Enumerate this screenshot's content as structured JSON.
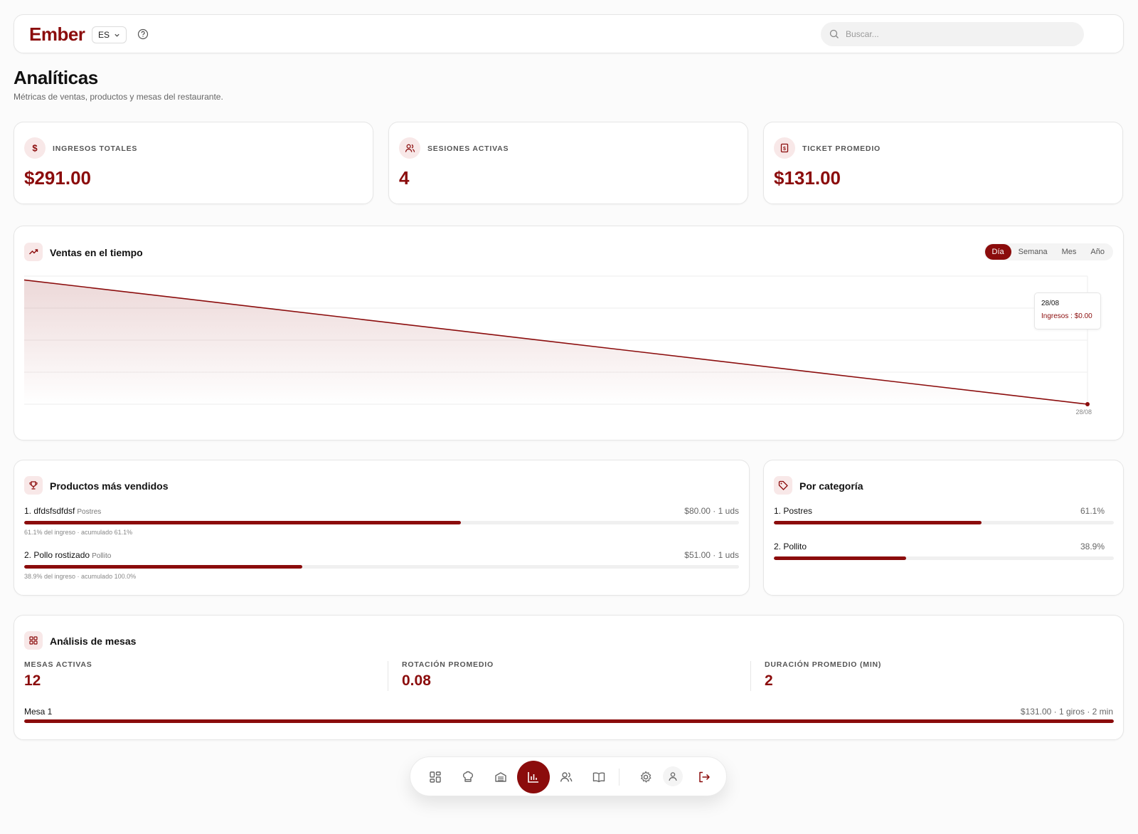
{
  "header": {
    "logo": "Ember",
    "language": "ES",
    "search_placeholder": "Buscar..."
  },
  "page": {
    "title": "Analíticas",
    "subtitle": "Métricas de ventas, productos y mesas del restaurante."
  },
  "kpis": [
    {
      "label": "INGRESOS TOTALES",
      "value": "$291.00",
      "icon": "dollar-icon"
    },
    {
      "label": "SESIONES ACTIVAS",
      "value": "4",
      "icon": "users-icon"
    },
    {
      "label": "TICKET PROMEDIO",
      "value": "$131.00",
      "icon": "receipt-icon"
    }
  ],
  "sales_chart": {
    "title": "Ventas en el tiempo",
    "ranges": [
      "Día",
      "Semana",
      "Mes",
      "Año"
    ],
    "active_range": "Día",
    "tooltip": {
      "date": "28/08",
      "label": "Ingresos : $0.00"
    },
    "x_tick": "28/08"
  },
  "chart_data": {
    "type": "area",
    "title": "Ventas en el tiempo",
    "x": [
      "",
      "28/08"
    ],
    "series": [
      {
        "name": "Ingresos",
        "values": [
          291,
          0
        ]
      }
    ],
    "ylim": [
      0,
      300
    ],
    "grid": true,
    "color": "#8b0c0c"
  },
  "top_products": {
    "title": "Productos más vendidos",
    "items": [
      {
        "rank_name": "1. dfdsfsdfdsf",
        "category": "Postres",
        "right": "$80.00 · 1 uds",
        "share": 0.611,
        "note": "61.1% del ingreso · acumulado 61.1%"
      },
      {
        "rank_name": "2. Pollo rostizado",
        "category": "Pollito",
        "right": "$51.00 · 1 uds",
        "share": 0.389,
        "note": "38.9% del ingreso · acumulado 100.0%"
      }
    ]
  },
  "by_category": {
    "title": "Por categoría",
    "items": [
      {
        "name": "1. Postres",
        "pct": "61.1%",
        "share": 0.611
      },
      {
        "name": "2. Pollito",
        "pct": "38.9%",
        "share": 0.389
      }
    ]
  },
  "tables": {
    "title": "Análisis de mesas",
    "metrics": [
      {
        "label": "MESAS ACTIVAS",
        "value": "12"
      },
      {
        "label": "ROTACIÓN PROMEDIO",
        "value": "0.08"
      },
      {
        "label": "DURACIÓN PROMEDIO (MIN)",
        "value": "2"
      }
    ],
    "rows": [
      {
        "name": "Mesa 1",
        "detail": "$131.00 · 1 giros · 2 min",
        "share": 1.0
      }
    ]
  },
  "dock": {
    "items": [
      "dashboard-icon",
      "chef-hat-icon",
      "kitchen-icon",
      "analytics-icon",
      "users-icon",
      "menu-book-icon",
      "settings-icon",
      "profile-icon",
      "logout-icon"
    ],
    "active": "analytics-icon"
  },
  "colors": {
    "brand": "#8b0c0c",
    "brand_soft": "#f8e8e8"
  }
}
